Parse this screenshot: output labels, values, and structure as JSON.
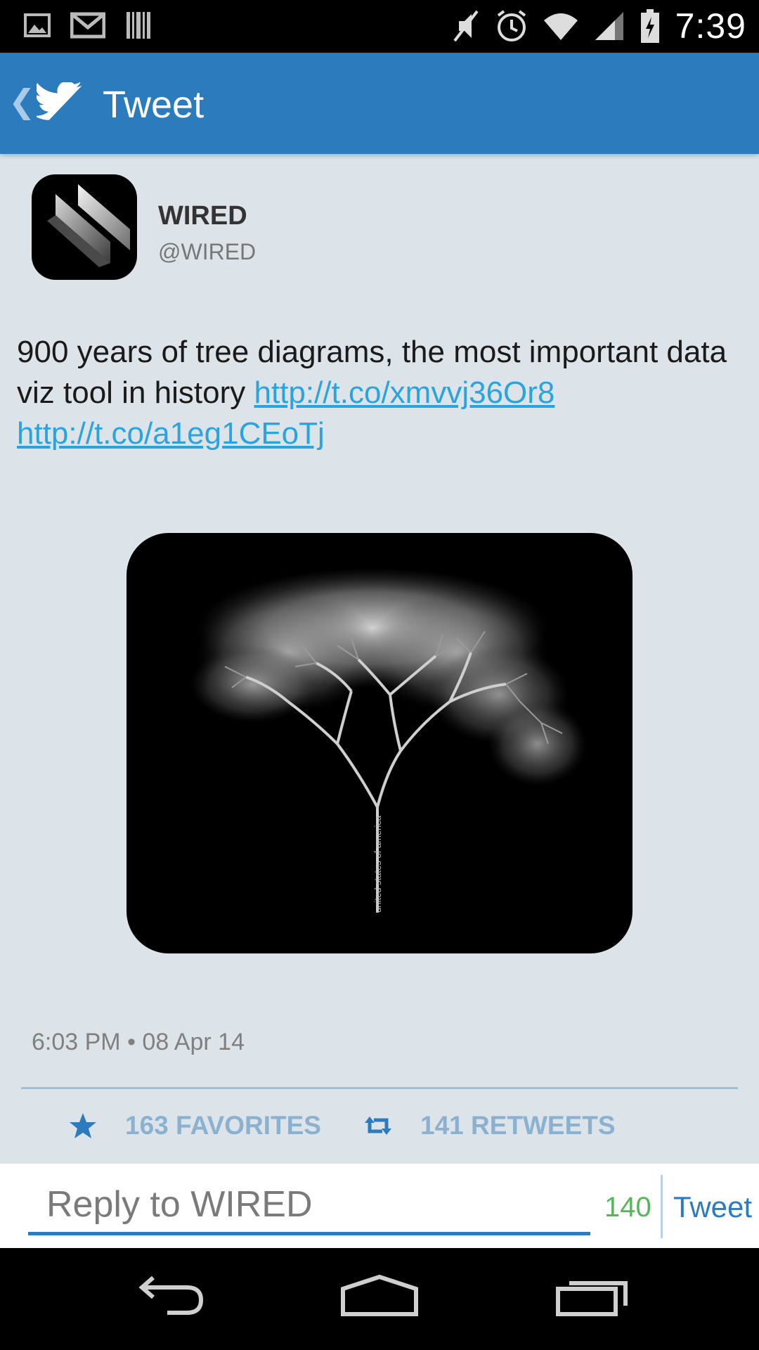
{
  "status_bar": {
    "time": "7:39",
    "icons": [
      "image-notification-icon",
      "gmail-icon",
      "barcode-icon",
      "mute-icon",
      "alarm-icon",
      "wifi-icon",
      "signal-icon",
      "battery-charging-icon"
    ]
  },
  "action_bar": {
    "title": "Tweet",
    "icons": [
      "back-chevron-icon",
      "twitter-bird-icon"
    ]
  },
  "tweet": {
    "author_name": "WIRED",
    "author_handle": "@WIRED",
    "text": "900 years of tree diagrams, the most important data viz tool in history ",
    "link1": "http://t.co/xmvvj36Or8",
    "link2": "http://t.co/a1eg1CEoTj",
    "image_caption": "united states of america",
    "timestamp": "6:03 PM • 08 Apr 14"
  },
  "stats": {
    "favorites": "163 FAVORITES",
    "retweets": "141 RETWEETS"
  },
  "reply": {
    "placeholder": "Reply to WIRED",
    "char_count": "140",
    "tweet_button": "Tweet"
  },
  "colors": {
    "action_bar": "#2b7bbd",
    "background": "#dde4e9",
    "link": "#2aa4de",
    "stat_text": "#8ab1d0",
    "char_count": "#58b55c"
  }
}
